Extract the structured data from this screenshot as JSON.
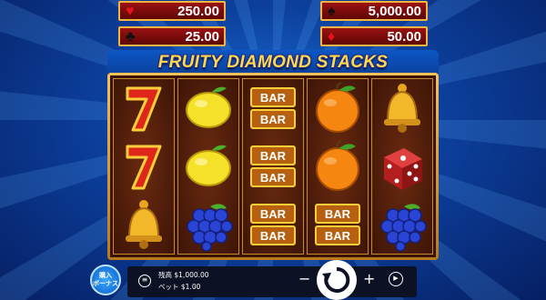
{
  "payouts": {
    "heart": {
      "suit": "♥",
      "value": "250.00"
    },
    "club": {
      "suit": "♣",
      "value": "25.00"
    },
    "spade": {
      "suit": "♠",
      "value": "5,000.00"
    },
    "diamond": {
      "suit": "♦",
      "value": "50.00"
    }
  },
  "title": "FRUITY DIAMOND STACKS",
  "reels": [
    [
      "seven-icon",
      "seven-icon",
      "bell-icon"
    ],
    [
      "lemon-icon",
      "lemon-icon",
      "grapes-icon"
    ],
    [
      "bar-icon",
      "bar-icon",
      "bar-icon"
    ],
    [
      "orange-icon",
      "orange-icon",
      "bar-icon"
    ],
    [
      "bell-icon",
      "dice-icon",
      "grapes-icon"
    ]
  ],
  "bar_label": "BAR",
  "bonus_button": "購入\nボーナス",
  "balance": {
    "label": "残高",
    "value": "$1,000.00"
  },
  "bet": {
    "label": "ベット",
    "value": "$1.00"
  },
  "controls": {
    "minus": "−",
    "plus": "+",
    "menu": "≡",
    "autoplay": "▶"
  },
  "colors": {
    "payout_bg": "#8a0e0e",
    "payout_border": "#f2b544",
    "title": "#ffd84a",
    "reel_bg": "#4a1a08"
  }
}
